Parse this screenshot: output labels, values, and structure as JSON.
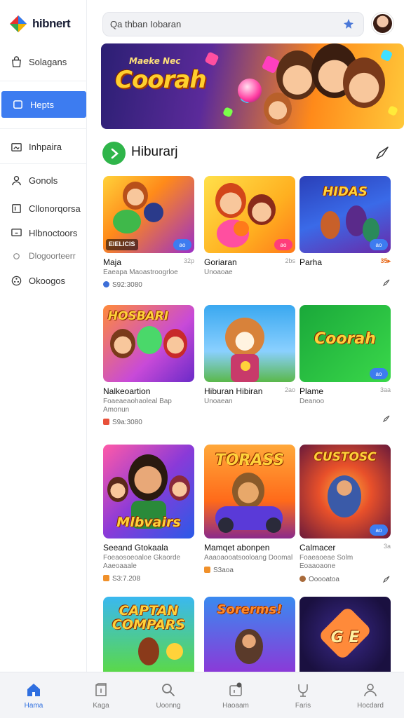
{
  "app": {
    "name": "hibnert"
  },
  "sidebar": {
    "items": [
      {
        "label": "Solagans",
        "icon": "bag-icon",
        "active": false
      },
      {
        "label": "Hepts",
        "icon": "chat-icon",
        "active": true
      },
      {
        "label": "Inhpaira",
        "icon": "gallery-icon",
        "active": false
      },
      {
        "label": "Gonols",
        "icon": "user-icon",
        "active": false
      },
      {
        "label": "Cllonorqorsa",
        "icon": "bookmark-icon",
        "active": false
      },
      {
        "label": "Hlbnoctoors",
        "icon": "monitor-icon",
        "active": false
      },
      {
        "label": "Dlogoorteerr",
        "icon": "circle-icon",
        "active": false
      },
      {
        "label": "Okoogos",
        "icon": "settings-icon",
        "active": false
      }
    ]
  },
  "search": {
    "placeholder": "Qa thban Iobaran"
  },
  "banner": {
    "subtitle": "Maeke Nec",
    "title": "Coorah"
  },
  "section": {
    "title": "Hiburarj"
  },
  "games": [
    {
      "title": "Maja",
      "right": "32p",
      "sub": "Eaeapa Maoastroogrloe",
      "meta": "S92:3080",
      "thumb_label": "EIELICIS",
      "chip": "ao"
    },
    {
      "title": "Goriaran",
      "right": "2bs",
      "sub": "Unoaoae",
      "meta": "",
      "thumb_label": "",
      "chip": "ao"
    },
    {
      "title": "Parha",
      "right": "35▸",
      "sub": "",
      "meta": "",
      "thumb_label": "HIDAS",
      "chip": "ao"
    },
    {
      "title": "Nalkeoartion",
      "right": "",
      "sub": "Foaeaeaohaoleal Bap Amonun",
      "meta": "S9a:3080",
      "thumb_label": "HOSBARI",
      "chip": ""
    },
    {
      "title": "Hiburan Hibiran",
      "right": "2ao",
      "sub": "Unoaean",
      "meta": "",
      "thumb_label": "",
      "chip": ""
    },
    {
      "title": "Plame",
      "right": "3aa",
      "sub": "Deanoo",
      "meta": "",
      "thumb_label": "Coorah",
      "chip": "ao"
    },
    {
      "title": "Seeand Gtokaala",
      "right": "",
      "sub": "Foeaosoeoaloe Gkaorde Aaeoaaale",
      "meta": "S3:7.208",
      "thumb_label": "Mlbvairs",
      "chip": ""
    },
    {
      "title": "Mamqet abonpen",
      "right": "",
      "sub": "Aaaoaooatsooloang Doomal",
      "meta": "S3aoa",
      "thumb_label": "TORASS",
      "chip": ""
    },
    {
      "title": "Calmacer",
      "right": "3a",
      "sub": "Foaeaoeae Solm Eoaaoaone",
      "meta": "Ooooatoa",
      "thumb_label": "CUSTOSC",
      "chip": "ao"
    },
    {
      "title": "",
      "right": "",
      "sub": "",
      "meta": "",
      "thumb_label": "CAPTAN COMPARS",
      "chip": ""
    },
    {
      "title": "",
      "right": "",
      "sub": "",
      "meta": "",
      "thumb_label": "Sorerms!",
      "chip": ""
    },
    {
      "title": "",
      "right": "",
      "sub": "",
      "meta": "",
      "thumb_label": "G E",
      "chip": ""
    }
  ],
  "bottom_nav": [
    {
      "label": "Hama",
      "icon": "home-icon",
      "active": true
    },
    {
      "label": "Kaga",
      "icon": "library-icon",
      "active": false
    },
    {
      "label": "Uoonng",
      "icon": "search-icon",
      "active": false
    },
    {
      "label": "Haoaam",
      "icon": "notification-icon",
      "active": false
    },
    {
      "label": "Faris",
      "icon": "store-icon",
      "active": false
    },
    {
      "label": "Hocdard",
      "icon": "profile-icon",
      "active": false
    }
  ],
  "colors": {
    "accent": "#3d7cf0",
    "section_icon": "#2fb54a",
    "nav_active": "#2f6fe0"
  }
}
